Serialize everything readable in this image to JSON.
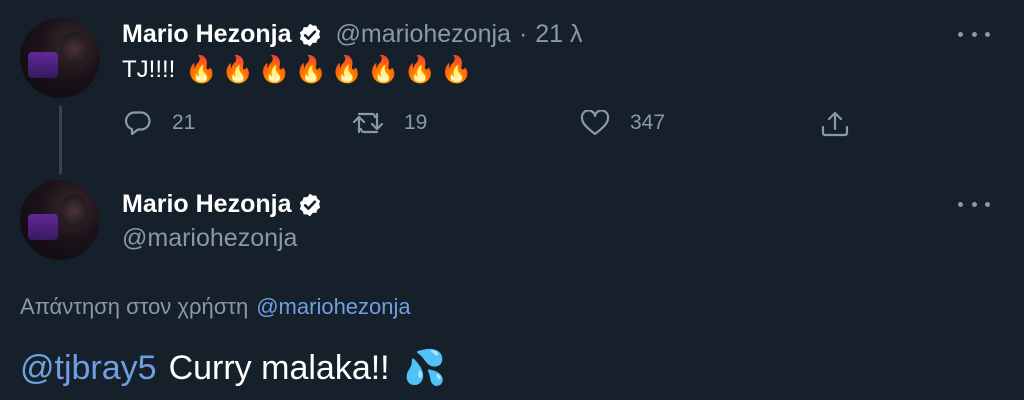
{
  "tweet1": {
    "author_name": "Mario Hezonja",
    "handle": "@mariohezonja",
    "separator": "·",
    "time": "21 λ",
    "text": "TJ!!!!",
    "emoji": [
      "🔥",
      "🔥",
      "🔥",
      "🔥",
      "🔥",
      "🔥",
      "🔥",
      "🔥"
    ],
    "actions": {
      "reply_count": "21",
      "retweet_count": "19",
      "like_count": "347"
    }
  },
  "tweet2": {
    "author_name": "Mario Hezonja",
    "handle": "@mariohezonja",
    "reply_to_label": "Απάντηση στον χρήστη",
    "reply_to_handle": "@mariohezonja",
    "mention": "@tjbray5",
    "text": "Curry malaka!!",
    "emoji": "💦"
  },
  "colors": {
    "background": "#15202b",
    "muted": "#8b98a5",
    "link": "#6f9fe0"
  }
}
